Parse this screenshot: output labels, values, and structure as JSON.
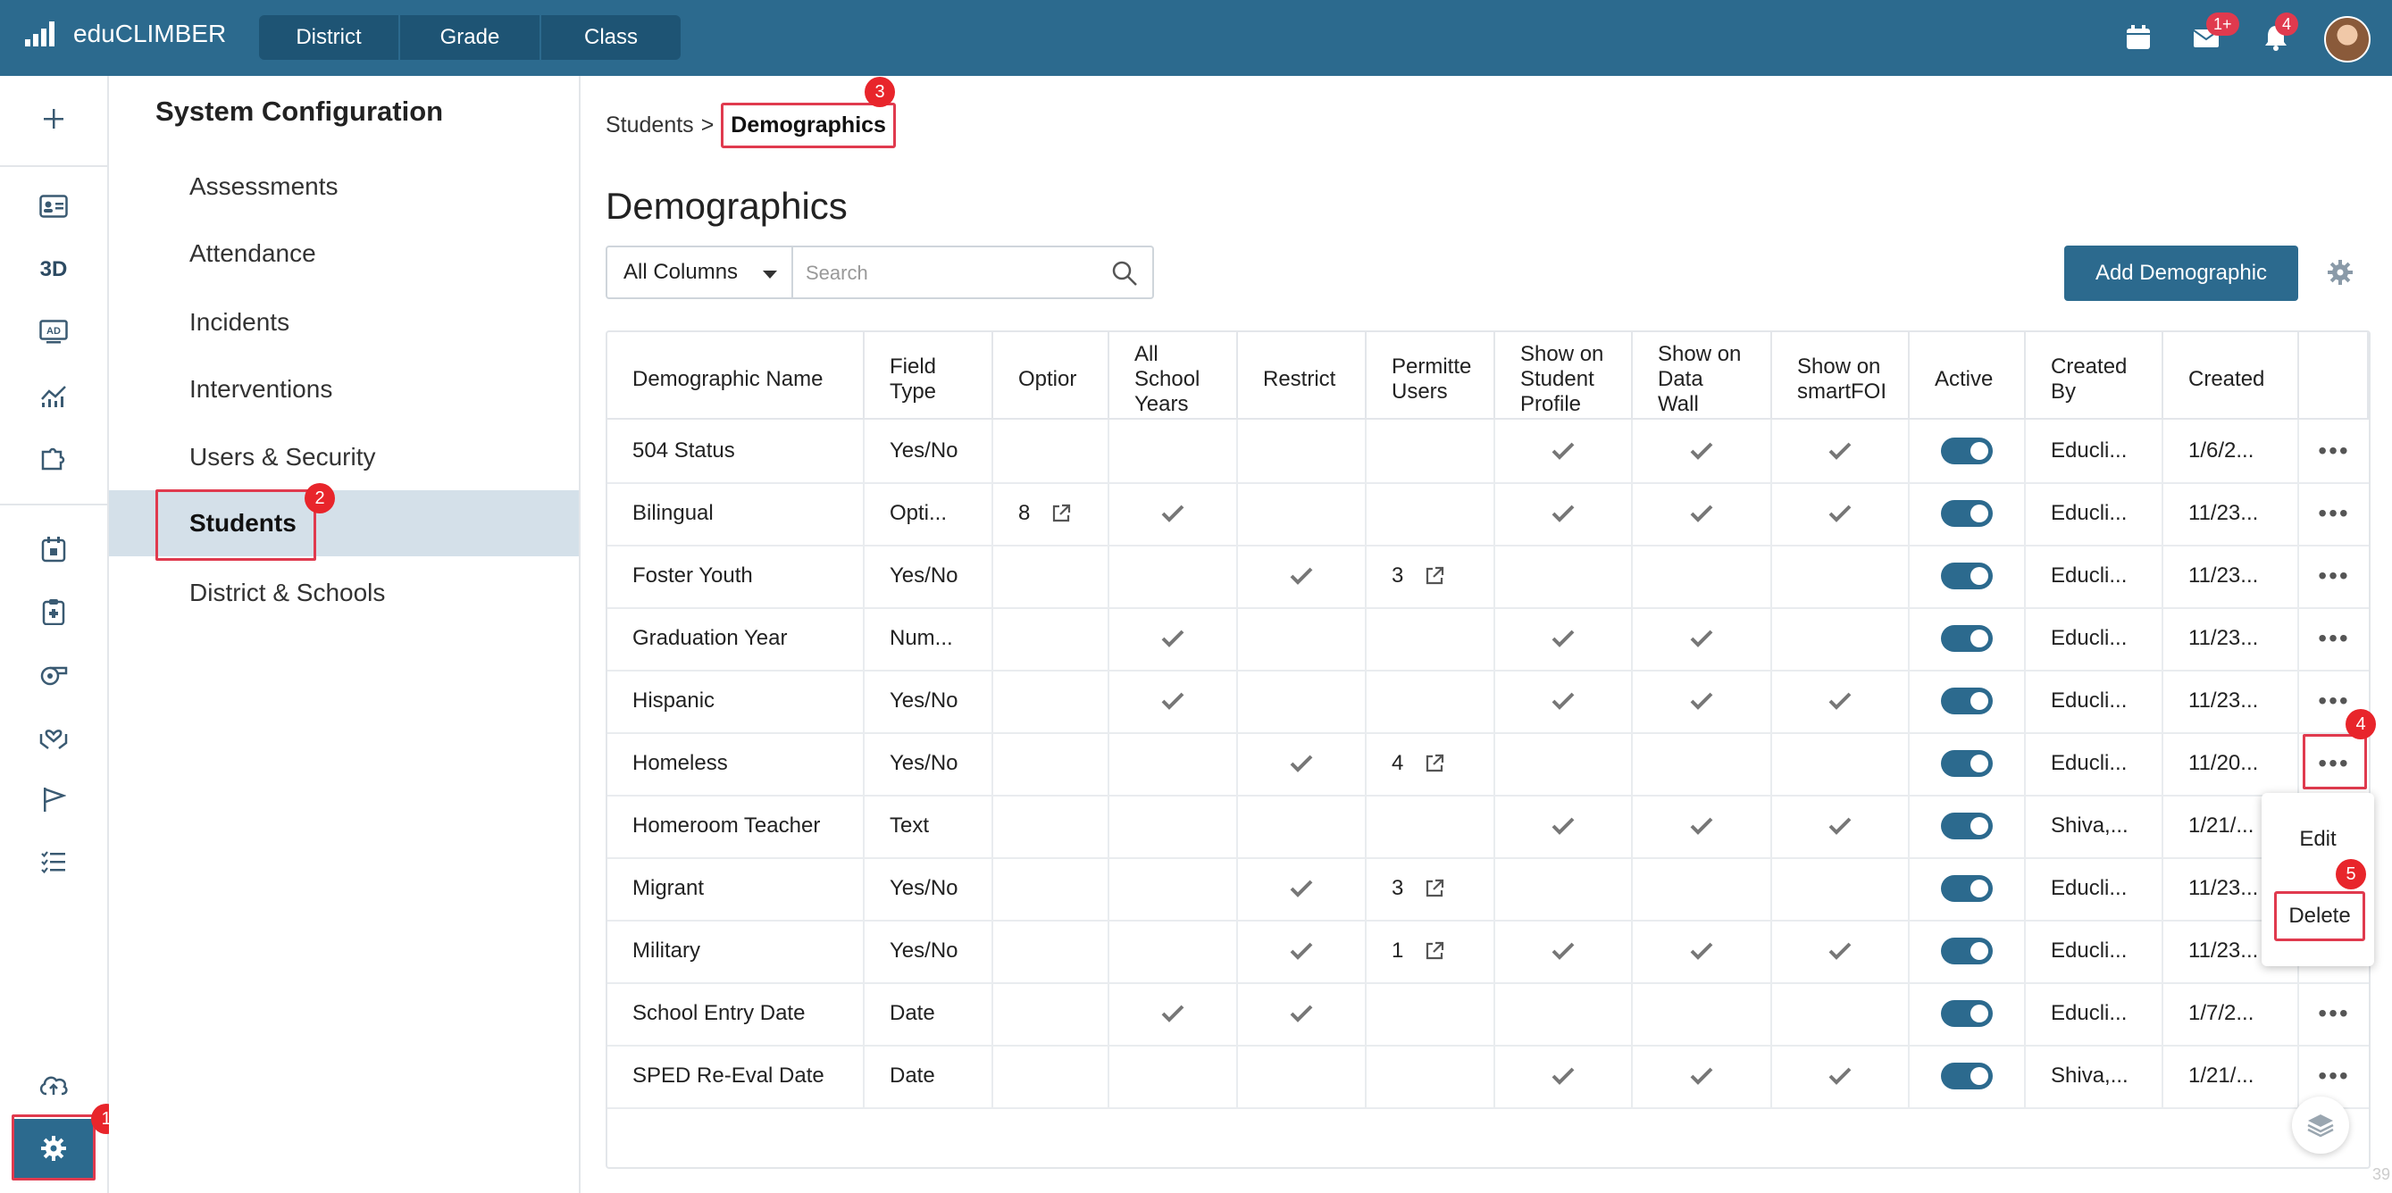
{
  "app": {
    "name": "eduCLIMBER"
  },
  "nav_tabs": [
    "District",
    "Grade",
    "Class"
  ],
  "topbar": {
    "mail_badge": "1+",
    "notif_badge": "4"
  },
  "sidebar": {
    "title": "System Configuration",
    "items": [
      "Assessments",
      "Attendance",
      "Incidents",
      "Interventions",
      "Users & Security",
      "Students",
      "District & Schools"
    ],
    "active": "Students"
  },
  "breadcrumb": {
    "parent": "Students",
    "separator": ">",
    "current": "Demographics"
  },
  "page": {
    "title": "Demographics",
    "add_button": "Add Demographic"
  },
  "filter": {
    "columns_selected": "All Columns",
    "search_placeholder": "Search"
  },
  "table": {
    "columns": [
      "Demographic Name",
      "Field\nType",
      "Optior",
      "All\nSchool\nYears",
      "Restrict",
      "Permitte\nUsers",
      "Show on\nStudent\nProfile",
      "Show on\nData\nWall",
      "Show on\nsmartFOI",
      "Active",
      "Created\nBy",
      "Created",
      ""
    ],
    "rows": [
      {
        "name": "504 Status",
        "type": "Yes/No",
        "options": "",
        "all_years": false,
        "restrict": false,
        "permitted": "",
        "profile": true,
        "wall": true,
        "smart": true,
        "active": true,
        "by": "Educli...",
        "created": "1/6/2..."
      },
      {
        "name": "Bilingual",
        "type": "Opti...",
        "options": "8",
        "all_years": true,
        "restrict": false,
        "permitted": "",
        "profile": true,
        "wall": true,
        "smart": true,
        "active": true,
        "by": "Educli...",
        "created": "11/23..."
      },
      {
        "name": "Foster Youth",
        "type": "Yes/No",
        "options": "",
        "all_years": false,
        "restrict": true,
        "permitted": "3",
        "profile": false,
        "wall": false,
        "smart": false,
        "active": true,
        "by": "Educli...",
        "created": "11/23..."
      },
      {
        "name": "Graduation Year",
        "type": "Num...",
        "options": "",
        "all_years": true,
        "restrict": false,
        "permitted": "",
        "profile": true,
        "wall": true,
        "smart": false,
        "active": true,
        "by": "Educli...",
        "created": "11/23..."
      },
      {
        "name": "Hispanic",
        "type": "Yes/No",
        "options": "",
        "all_years": true,
        "restrict": false,
        "permitted": "",
        "profile": true,
        "wall": true,
        "smart": true,
        "active": true,
        "by": "Educli...",
        "created": "11/23..."
      },
      {
        "name": "Homeless",
        "type": "Yes/No",
        "options": "",
        "all_years": false,
        "restrict": true,
        "permitted": "4",
        "profile": false,
        "wall": false,
        "smart": false,
        "active": true,
        "by": "Educli...",
        "created": "11/20..."
      },
      {
        "name": "Homeroom Teacher",
        "type": "Text",
        "options": "",
        "all_years": false,
        "restrict": false,
        "permitted": "",
        "profile": true,
        "wall": true,
        "smart": true,
        "active": true,
        "by": "Shiva,...",
        "created": "1/21/..."
      },
      {
        "name": "Migrant",
        "type": "Yes/No",
        "options": "",
        "all_years": false,
        "restrict": true,
        "permitted": "3",
        "profile": false,
        "wall": false,
        "smart": false,
        "active": true,
        "by": "Educli...",
        "created": "11/23..."
      },
      {
        "name": "Military",
        "type": "Yes/No",
        "options": "",
        "all_years": false,
        "restrict": true,
        "permitted": "1",
        "profile": true,
        "wall": true,
        "smart": true,
        "active": true,
        "by": "Educli...",
        "created": "11/23..."
      },
      {
        "name": "School Entry Date",
        "type": "Date",
        "options": "",
        "all_years": true,
        "restrict": true,
        "permitted": "",
        "profile": false,
        "wall": false,
        "smart": false,
        "active": true,
        "by": "Educli...",
        "created": "1/7/2..."
      },
      {
        "name": "SPED Re-Eval Date",
        "type": "Date",
        "options": "",
        "all_years": false,
        "restrict": false,
        "permitted": "",
        "profile": true,
        "wall": true,
        "smart": true,
        "active": true,
        "by": "Shiva,...",
        "created": "1/21/..."
      }
    ]
  },
  "context_menu": {
    "items": [
      "Edit",
      "Delete"
    ]
  },
  "annotations": [
    "1",
    "2",
    "3",
    "4",
    "5"
  ],
  "corner_text": "39"
}
